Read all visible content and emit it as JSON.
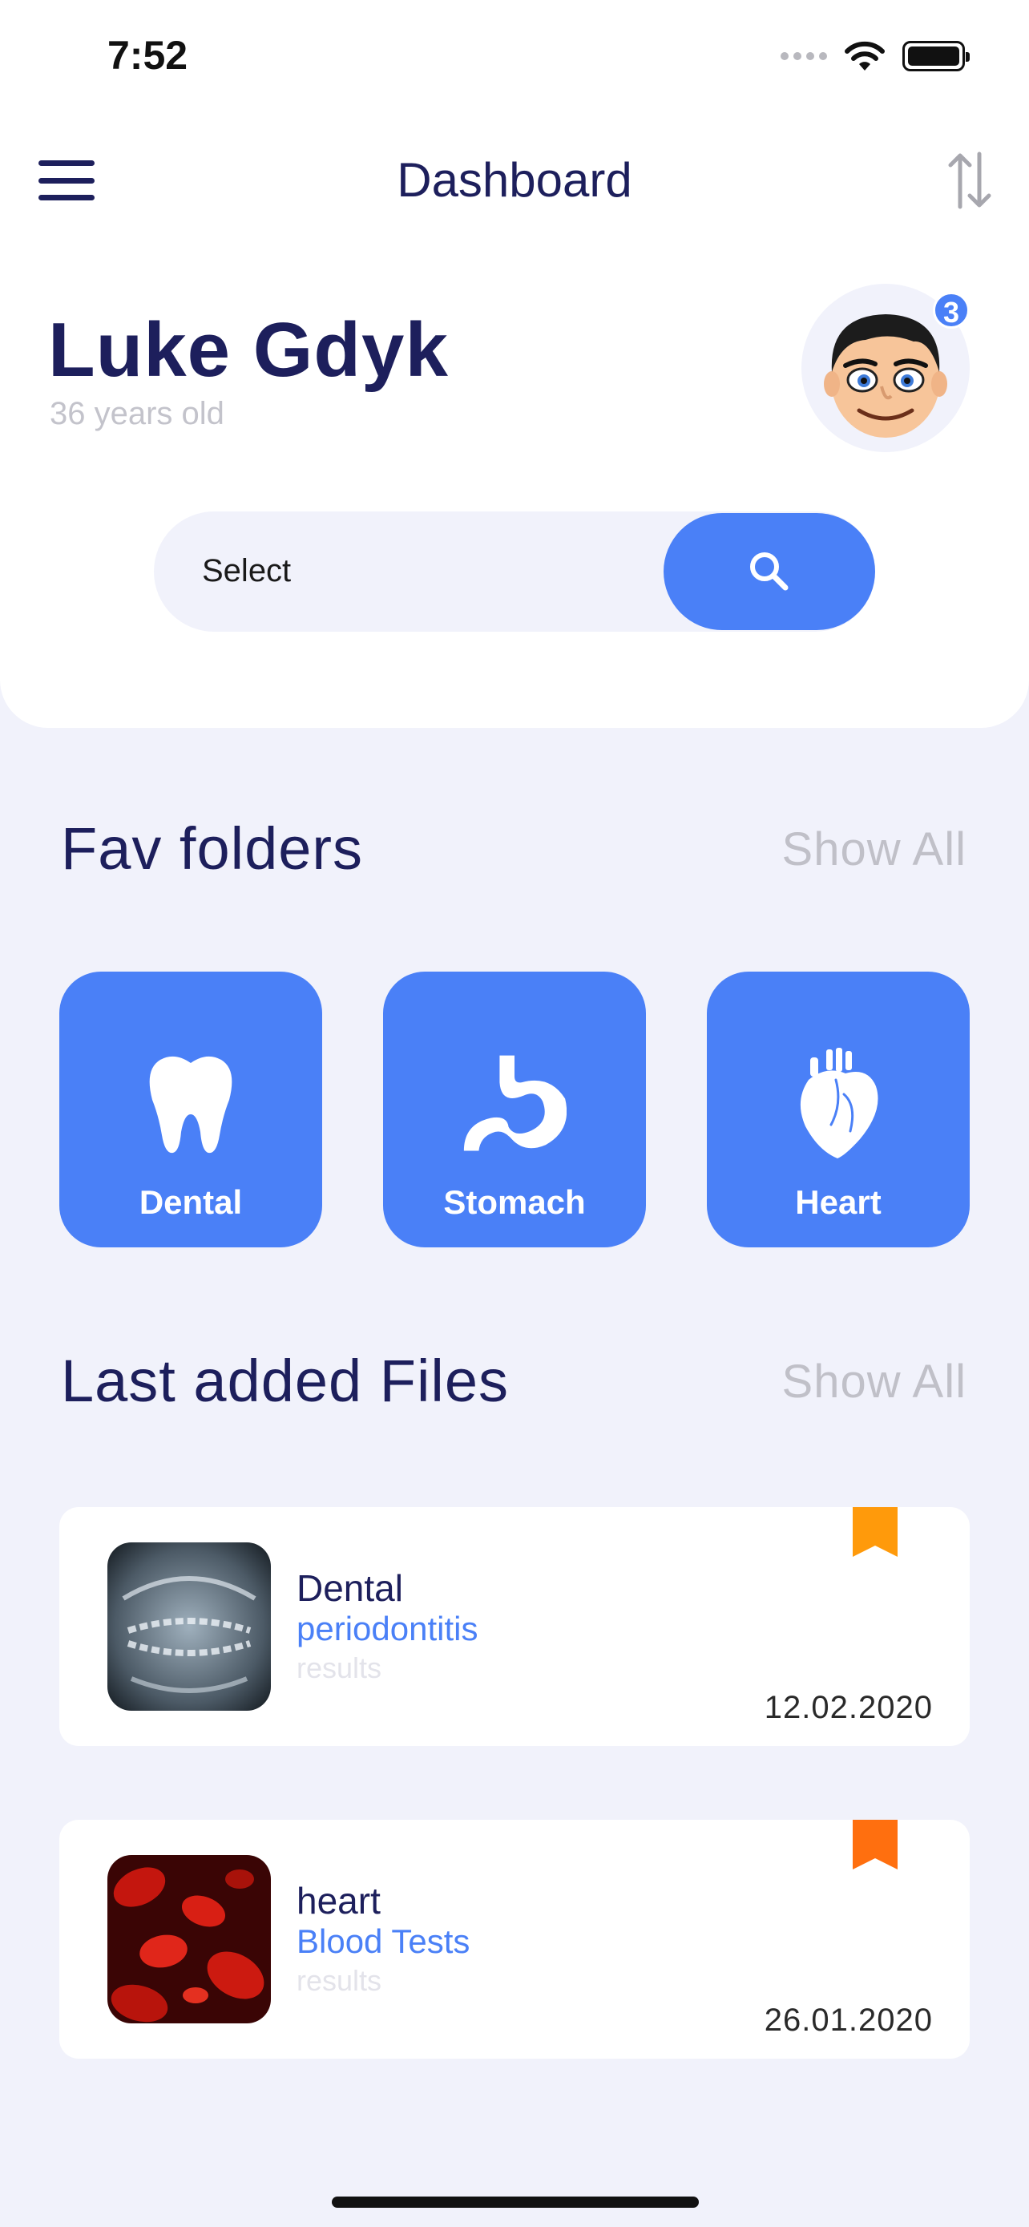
{
  "status_bar": {
    "time": "7:52"
  },
  "nav": {
    "title": "Dashboard"
  },
  "profile": {
    "name": "Luke Gdyk",
    "age": "36 years old",
    "notification_count": "3"
  },
  "search": {
    "placeholder": "Select"
  },
  "fav_folders": {
    "title": "Fav folders",
    "show_all": "Show All",
    "items": [
      {
        "label": "Dental",
        "icon": "tooth-icon"
      },
      {
        "label": "Stomach",
        "icon": "stomach-icon"
      },
      {
        "label": "Heart",
        "icon": "heart-organ-icon"
      }
    ]
  },
  "last_files": {
    "title": "Last added Files",
    "show_all": "Show All",
    "items": [
      {
        "title": "Dental",
        "subtitle": "periodontitis",
        "note": "results",
        "date": "12.02.2020",
        "bookmark_color": "#ff9a0b"
      },
      {
        "title": "heart",
        "subtitle": "Blood Tests",
        "note": "results",
        "date": "26.01.2020",
        "bookmark_color": "#ff6f0f"
      }
    ]
  },
  "colors": {
    "accent": "#4a80f7",
    "navy": "#1d1f5c",
    "background": "#f1f2fb"
  }
}
